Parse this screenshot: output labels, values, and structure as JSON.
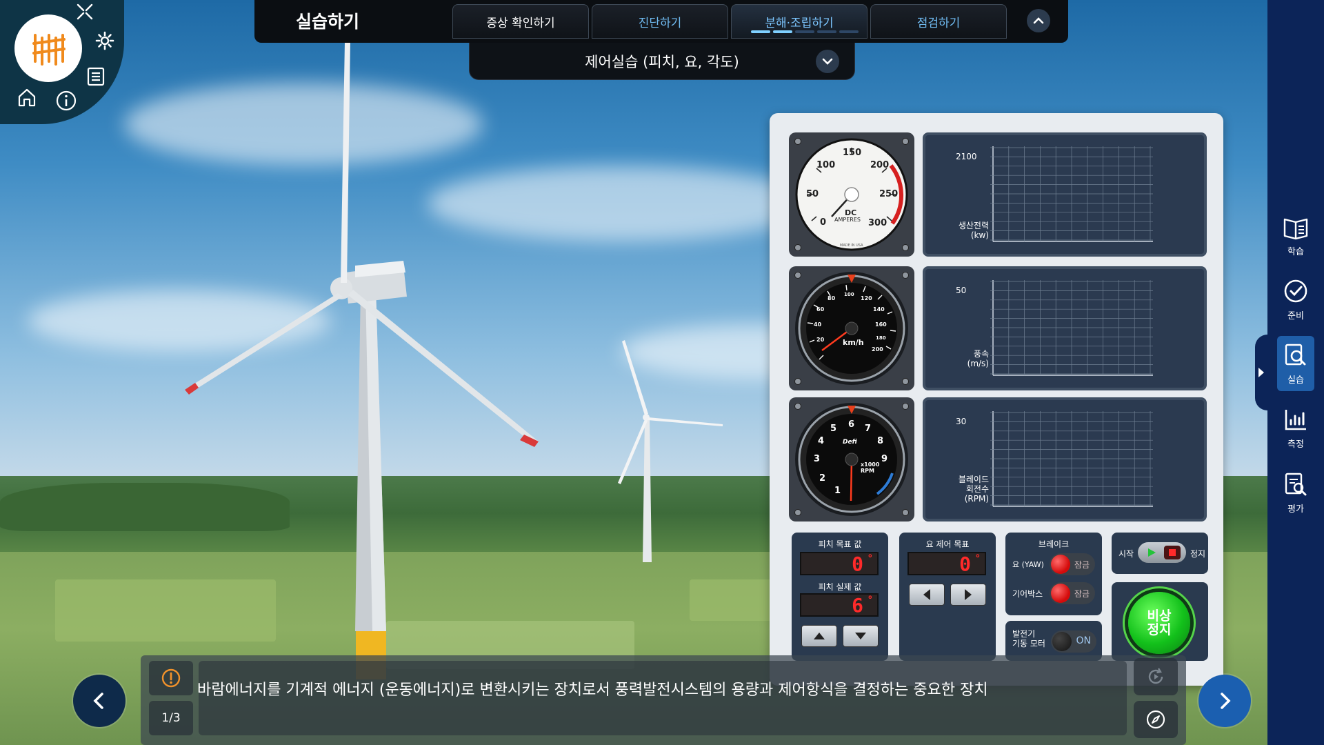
{
  "header": {
    "title": "실습하기",
    "tabs": [
      {
        "label": "증상 확인하기"
      },
      {
        "label": "진단하기"
      },
      {
        "label": "분해·조립하기"
      },
      {
        "label": "점검하기"
      }
    ],
    "active_tab_progress": [
      true,
      true,
      false,
      false,
      false
    ]
  },
  "subheader": {
    "label": "제어실습 (피치, 요, 각도)"
  },
  "gauges": {
    "ammeter": {
      "ticks": [
        "0",
        "50",
        "100",
        "150",
        "200",
        "250",
        "300"
      ],
      "unit_top": "DC",
      "unit_bottom": "AMPERES",
      "footer": "MADE IN USA"
    },
    "speedometer": {
      "unit": "km/h",
      "ticks": [
        "20",
        "40",
        "60",
        "80",
        "100",
        "120",
        "140",
        "160",
        "180",
        "200"
      ]
    },
    "tachometer": {
      "ticks": [
        "1",
        "2",
        "3",
        "4",
        "5",
        "6",
        "7",
        "8",
        "9"
      ],
      "brand": "Defi",
      "unit": "x1000 RPM"
    }
  },
  "graphs": [
    {
      "max": "2100",
      "label_line1": "생산전력",
      "label_line2": "(kw)"
    },
    {
      "max": "50",
      "label_line1": "풍속",
      "label_line2": "(m/s)"
    },
    {
      "max": "30",
      "label_line1": "블레이드",
      "label_line2": "회전수",
      "label_line3": "(RPM)"
    }
  ],
  "controls": {
    "pitch": {
      "target_label": "피치 목표 값",
      "target_value": "0",
      "actual_label": "피치 실제 값",
      "actual_value": "6"
    },
    "yaw": {
      "target_label": "요 제어 목표",
      "target_value": "0"
    },
    "brake": {
      "title": "브레이크",
      "yaw_label": "요 (YAW)",
      "yaw_state": "잠금",
      "gearbox_label": "기어박스",
      "gearbox_state": "잠금"
    },
    "generator": {
      "label_line1": "발전기",
      "label_line2": "기동 모터",
      "state": "ON"
    },
    "run": {
      "start_label": "시작",
      "stop_label": "정지"
    },
    "emergency": {
      "line1": "비상",
      "line2": "정지"
    },
    "degree_symbol": "°"
  },
  "sidebar": {
    "items": [
      {
        "label": "학습"
      },
      {
        "label": "준비"
      },
      {
        "label": "실습"
      },
      {
        "label": "측정"
      },
      {
        "label": "평가"
      }
    ]
  },
  "narration": {
    "text": "바람에너지를 기계적 에너지 (운동에너지)로 변환시키는 장치로서 풍력발전시스템의 용량과 제어항식을 결정하는 중요한 장치",
    "page": "1/3"
  },
  "colors": {
    "accent": "#1f5ea8",
    "sidebar": "#0c2458",
    "segment_red": "#ff2a2a",
    "emergency_green": "#13c11b"
  }
}
